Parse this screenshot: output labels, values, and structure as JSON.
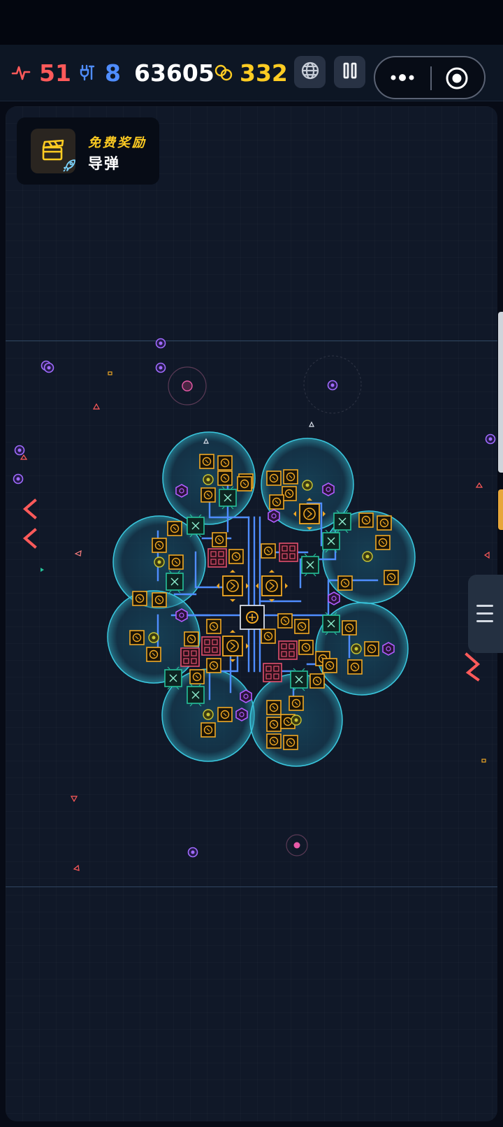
{
  "hud": {
    "health": {
      "icon": "heartbeat-icon",
      "value": "51",
      "color": "#ff5a5a"
    },
    "power": {
      "icon": "plug-icon",
      "value": "8",
      "color": "#4f8dff"
    },
    "score": {
      "value": "63605",
      "color": "#ffffff"
    },
    "coins": {
      "icon": "coin-icon",
      "value": "332",
      "color": "#ffcc22"
    },
    "buttons": [
      {
        "name": "globe-button",
        "icon": "globe-icon"
      },
      {
        "name": "pause-button",
        "icon": "pause-icon"
      }
    ],
    "capsule": {
      "more_icon": "more-dots-icon",
      "close_icon": "target-icon"
    }
  },
  "reward": {
    "title": "免费奖励",
    "subtitle": "导弹",
    "icon": "clapperboard-icon",
    "badge_icon": "rocket-icon",
    "accent": "#ffcc22"
  },
  "game": {
    "shield_color": "#39c6dd",
    "conduit_color": "#4f8dff",
    "module_color": "#f0a824",
    "reactor_color": "#26c29a",
    "enemy_color": "#a06bff",
    "hazard_color": "#ff5a5a"
  },
  "side_menu": {
    "icon": "menu-icon"
  }
}
